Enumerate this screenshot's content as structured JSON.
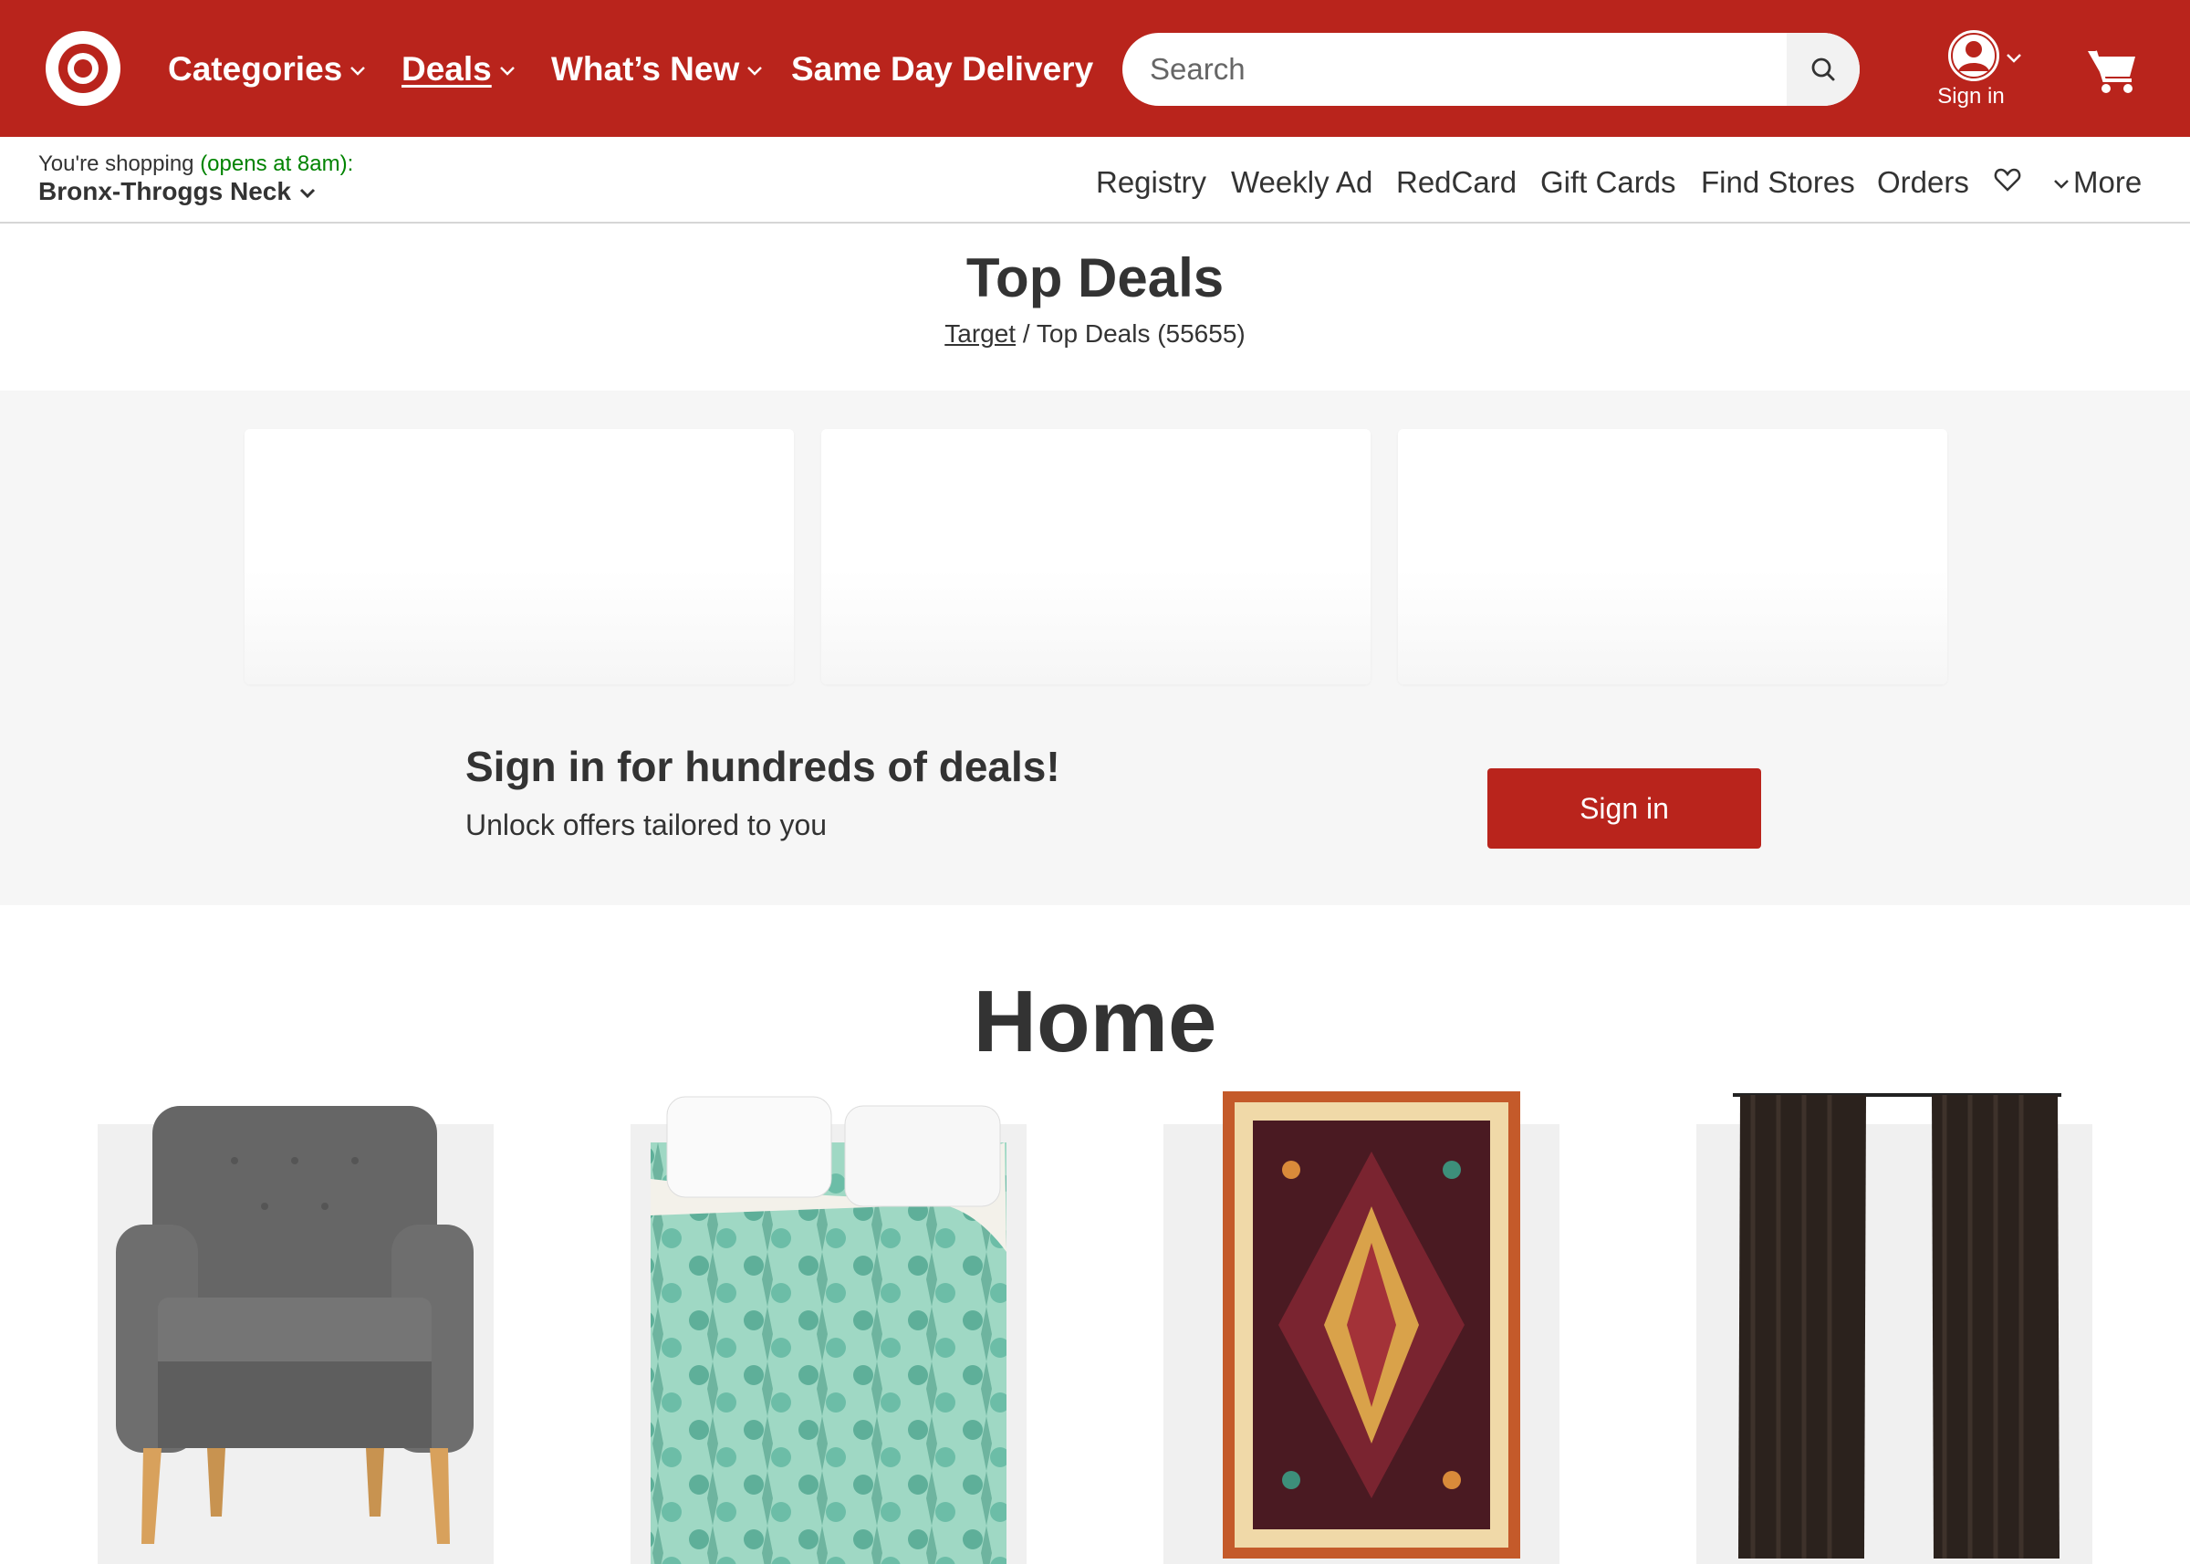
{
  "header": {
    "nav": [
      {
        "label": "Categories"
      },
      {
        "label": "Deals"
      },
      {
        "label": "What’s New"
      },
      {
        "label": "Same Day Delivery"
      }
    ],
    "search": {
      "placeholder": "Search"
    },
    "account": {
      "label": "Sign in"
    }
  },
  "store": {
    "prefix": "You're shopping",
    "opens": "(opens at 8am):",
    "name": "Bronx-Throggs Neck"
  },
  "sub_links": [
    "Registry",
    "Weekly Ad",
    "RedCard",
    "Gift Cards",
    "Find Stores",
    "Orders",
    "More"
  ],
  "page": {
    "title": "Top Deals",
    "breadcrumb_link": "Target",
    "breadcrumb_current": "/ Top Deals (55655)"
  },
  "signin_promo": {
    "heading": "Sign in for hundreds of deals!",
    "subtext": "Unlock offers tailored to you",
    "button": "Sign in"
  },
  "section": {
    "title": "Home"
  },
  "colors": {
    "brand_red": "#b9241c",
    "open_green": "#008300"
  },
  "icons": [
    "target-logo",
    "chevron-down-icon",
    "search-icon",
    "user-icon",
    "cart-icon",
    "heart-icon"
  ]
}
